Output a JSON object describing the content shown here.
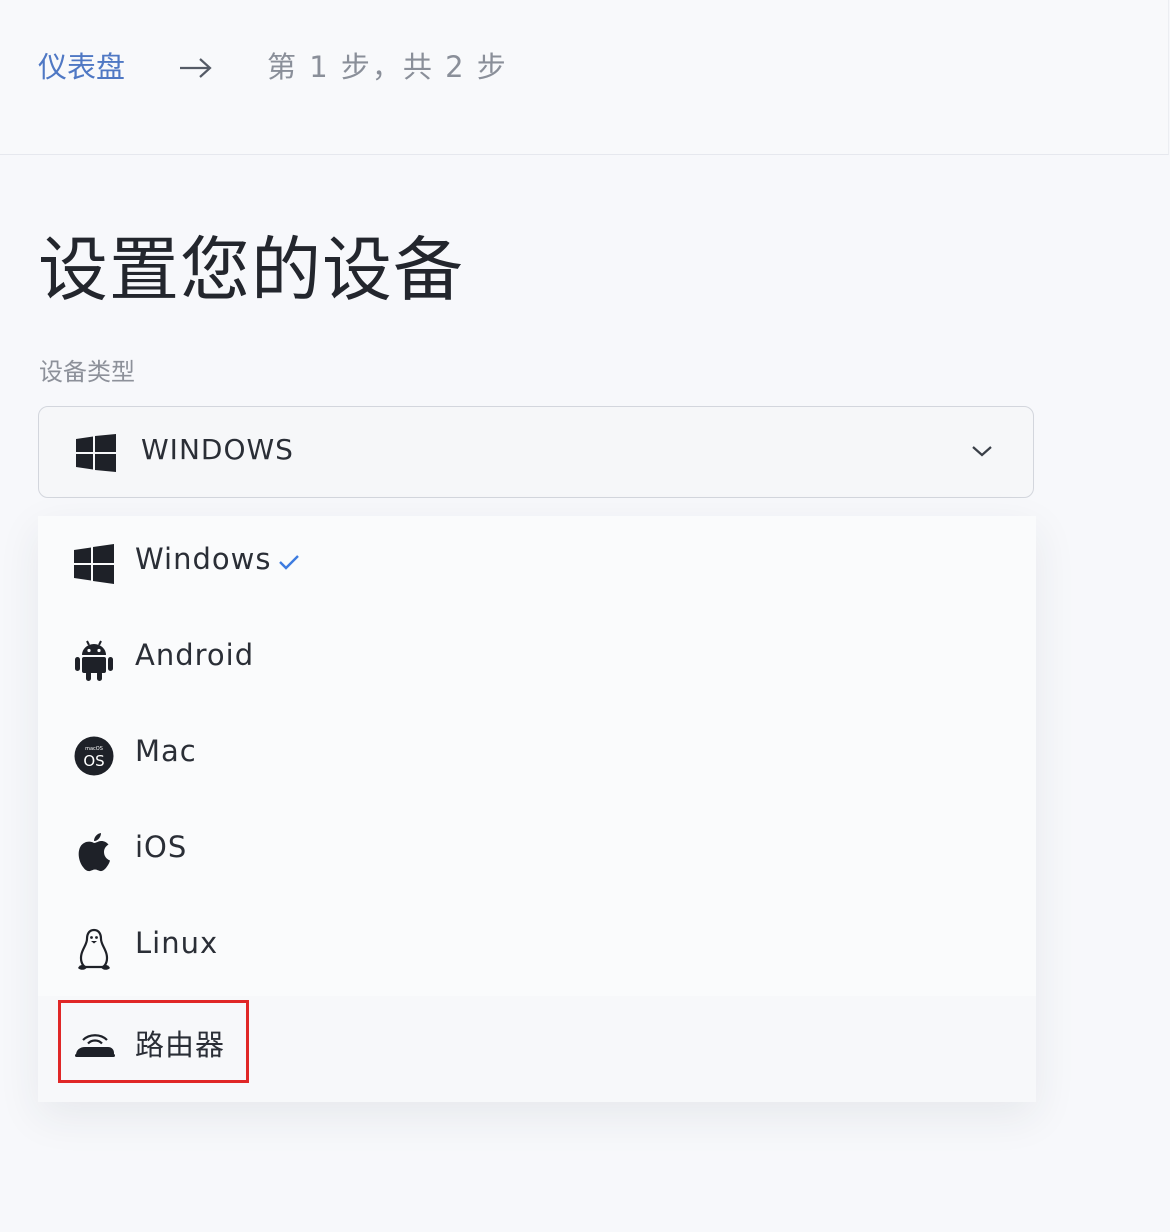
{
  "breadcrumb": {
    "dashboard": "仪表盘",
    "step": "第 1 步，共 2 步"
  },
  "page": {
    "title": "设置您的设备"
  },
  "device_type": {
    "label": "设备类型",
    "selected_value": "WINDOWS",
    "options": [
      {
        "label": "Windows",
        "icon": "windows-icon",
        "selected": true
      },
      {
        "label": "Android",
        "icon": "android-icon",
        "selected": false
      },
      {
        "label": "Mac",
        "icon": "macos-icon",
        "selected": false
      },
      {
        "label": "iOS",
        "icon": "apple-icon",
        "selected": false
      },
      {
        "label": "Linux",
        "icon": "linux-icon",
        "selected": false
      },
      {
        "label": "路由器",
        "icon": "router-icon",
        "selected": false
      }
    ]
  },
  "colors": {
    "link": "#4f78c4",
    "check": "#3d7be0",
    "highlight": "#e02727"
  }
}
